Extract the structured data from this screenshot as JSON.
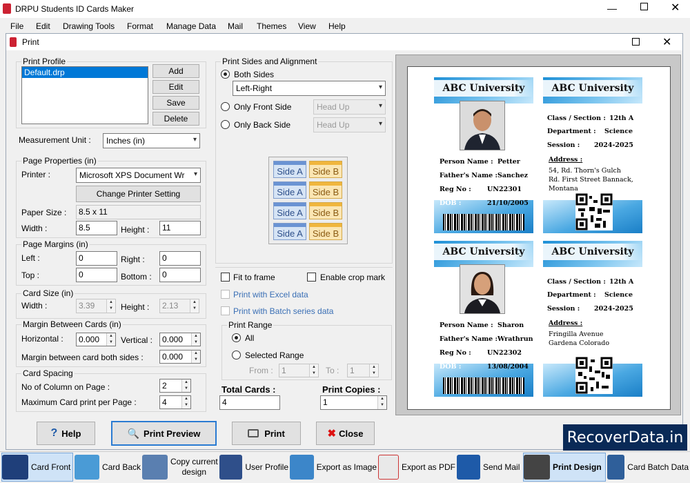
{
  "app": {
    "title": "DRPU Students ID Cards Maker"
  },
  "menu": [
    {
      "label": "File"
    },
    {
      "label": "Edit"
    },
    {
      "label": "Drawing Tools"
    },
    {
      "label": "Format"
    },
    {
      "label": "Manage Data"
    },
    {
      "label": "Mail"
    },
    {
      "label": "Themes"
    },
    {
      "label": "View"
    },
    {
      "label": "Help"
    }
  ],
  "dialog": {
    "title": "Print"
  },
  "print_profile": {
    "label": "Print Profile",
    "selected": "Default.drp",
    "add": "Add",
    "edit": "Edit",
    "save": "Save",
    "delete": "Delete"
  },
  "measurement": {
    "label": "Measurement Unit :",
    "value": "Inches (in)"
  },
  "page_props": {
    "label": "Page Properties (in)",
    "printer_label": "Printer :",
    "printer": "Microsoft XPS Document Wr",
    "change_btn": "Change Printer Setting",
    "paper_label": "Paper Size :",
    "paper": "8.5 x 11",
    "width_label": "Width :",
    "width": "8.5",
    "height_label": "Height :",
    "height": "11"
  },
  "margins": {
    "label": "Page Margins (in)",
    "left_label": "Left :",
    "left": "0",
    "right_label": "Right :",
    "right": "0",
    "top_label": "Top :",
    "top": "0",
    "bottom_label": "Bottom :",
    "bottom": "0"
  },
  "card_size": {
    "label": "Card Size (in)",
    "width_label": "Width :",
    "width": "3.39",
    "height_label": "Height :",
    "height": "2.13"
  },
  "margin_between": {
    "label": "Margin Between Cards (in)",
    "horizontal_label": "Horizontal :",
    "horizontal": "0.000",
    "vertical_label": "Vertical :",
    "vertical": "0.000",
    "both_label": "Margin between card both sides :",
    "both": "0.000"
  },
  "spacing": {
    "label": "Card Spacing",
    "cols_label": "No of Column on Page :",
    "cols": "2",
    "max_label": "Maximum Card print per Page :",
    "max": "4"
  },
  "sides": {
    "label": "Print Sides and Alignment",
    "both": "Both Sides",
    "both_value": "Left-Right",
    "front": "Only Front Side",
    "front_value": "Head Up",
    "back": "Only Back Side",
    "back_value": "Head Up",
    "side_a": "Side A",
    "side_b": "Side B"
  },
  "options": {
    "fit": "Fit to frame",
    "crop": "Enable crop mark",
    "excel": "Print with Excel data",
    "batch": "Print with Batch series data"
  },
  "range": {
    "label": "Print Range",
    "all": "All",
    "selected": "Selected Range",
    "from_label": "From :",
    "from": "1",
    "to_label": "To :",
    "to": "1"
  },
  "totals": {
    "total_label": "Total Cards :",
    "total": "4",
    "copies_label": "Print Copies :",
    "copies": "1"
  },
  "buttons": {
    "help": "Help",
    "preview": "Print Preview",
    "print": "Print",
    "close": "Close"
  },
  "watermark": "RecoverData.in",
  "cards": [
    {
      "university": "ABC University",
      "name_label": "Person Name :",
      "name": "Petter",
      "father_label": "Father's Name :",
      "father": "Sanchez",
      "reg_label": "Reg No :",
      "reg": "UN22301",
      "dob_label": "DOB :",
      "dob": "21/10/2005"
    },
    {
      "university": "ABC University",
      "class_label": "Class / Section :",
      "class": "12th A",
      "dept_label": "Department :",
      "dept": "Science",
      "session_label": "Session :",
      "session": "2024-2025",
      "address_label": "Address :",
      "address1": "54, Rd. Thorn's Gulch",
      "address2": "Rd. First Street Bannack,",
      "address3": "Montana"
    },
    {
      "university": "ABC University",
      "name_label": "Person Name :",
      "name": "Sharon",
      "father_label": "Father's Name :",
      "father": "Wrathrun",
      "reg_label": "Reg No :",
      "reg": "UN22302",
      "dob_label": "DOB :",
      "dob": "13/08/2004"
    },
    {
      "university": "ABC University",
      "class_label": "Class / Section :",
      "class": "12th A",
      "dept_label": "Department :",
      "dept": "Science",
      "session_label": "Session :",
      "session": "2024-2025",
      "address_label": "Address :",
      "address1": "Fringilla Avenue",
      "address2": "Gardena Colorado",
      "address3": ""
    }
  ],
  "toolbar": [
    {
      "label": "Card Front"
    },
    {
      "label": "Card Back"
    },
    {
      "label": "Copy current design"
    },
    {
      "label": "User Profile"
    },
    {
      "label": "Export as Image"
    },
    {
      "label": "Export as PDF"
    },
    {
      "label": "Send Mail"
    },
    {
      "label": "Print Design"
    },
    {
      "label": "Card Batch Data"
    }
  ]
}
